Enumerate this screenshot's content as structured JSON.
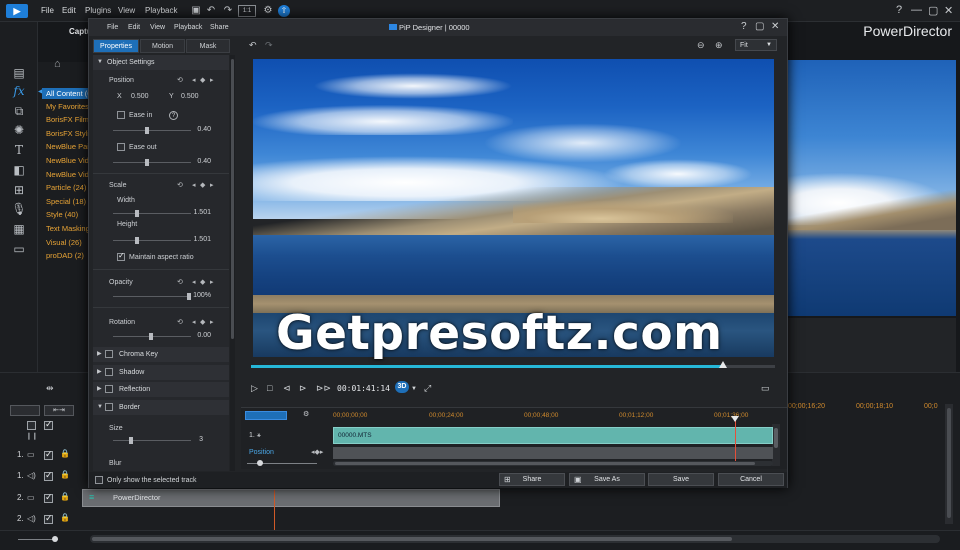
{
  "app": {
    "menus": [
      "File",
      "Edit",
      "Plugins",
      "View",
      "Playback"
    ],
    "brand": "PowerDirector",
    "capture_label": "Captu",
    "toolbar_zoom": "1:1"
  },
  "library": {
    "categories": [
      {
        "label": "All Content  (6)",
        "selected": true
      },
      {
        "label": "My Favorites"
      },
      {
        "label": "BorisFX Film S"
      },
      {
        "label": "BorisFX Styliz"
      },
      {
        "label": "NewBlue Paint"
      },
      {
        "label": "NewBlue Vide"
      },
      {
        "label": "NewBlue Vide"
      },
      {
        "label": "Particle  (24)"
      },
      {
        "label": "Special  (18)"
      },
      {
        "label": "Style  (40)"
      },
      {
        "label": "Text Masking"
      },
      {
        "label": "Visual  (26)"
      },
      {
        "label": "proDAD  (2)"
      }
    ]
  },
  "main_timeline": {
    "ruler": [
      "00;00;16;20",
      "00;00;18;10",
      "00;0"
    ],
    "tracks": [
      "1.",
      "1.",
      "2.",
      "2."
    ],
    "clip_label": "PowerDirector"
  },
  "dialog": {
    "menus": [
      "File",
      "Edit",
      "View",
      "Playback",
      "Share"
    ],
    "title": "PiP Designer  |  00000",
    "tabs": [
      "Properties",
      "Motion",
      "Mask"
    ],
    "object_settings": "Object Settings",
    "position": {
      "label": "Position",
      "x_label": "X",
      "x": "0.500",
      "y_label": "Y",
      "y": "0.500"
    },
    "ease_in": {
      "label": "Ease in",
      "value": "0.40"
    },
    "ease_out": {
      "label": "Ease out",
      "value": "0.40"
    },
    "scale": {
      "label": "Scale",
      "width_label": "Width",
      "width": "1.501",
      "height_label": "Height",
      "height": "1.501",
      "maintain": "Maintain aspect ratio"
    },
    "opacity": {
      "label": "Opacity",
      "value": "100%"
    },
    "rotation": {
      "label": "Rotation",
      "value": "0.00"
    },
    "sections": [
      "Chroma Key",
      "Shadow",
      "Reflection",
      "Border"
    ],
    "border": {
      "size_label": "Size",
      "size": "3",
      "blur_label": "Blur"
    },
    "fit": "Fit",
    "timecode": "00:01:41:14",
    "badge_3d": "3D",
    "timeline": {
      "ruler": [
        "00;00;00;00",
        "00;00;24;00",
        "00;00;48;00",
        "00;01;12;00",
        "00;01;36;00"
      ],
      "track_label": "1. ⚹",
      "position_label": "Position",
      "clip": "00000.MTS"
    },
    "only_selected": "Only show the selected track",
    "buttons": [
      "Share",
      "Save As",
      "Save",
      "Cancel"
    ]
  },
  "watermark": "Getpresoftz.com"
}
